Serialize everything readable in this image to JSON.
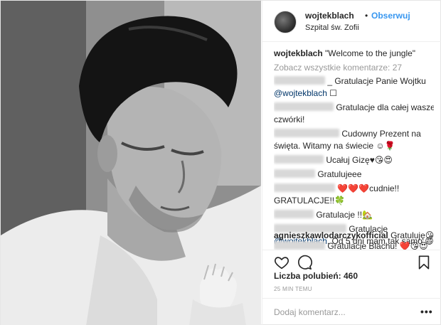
{
  "header": {
    "username": "wojtekblach",
    "dot": "•",
    "follow_label": "Obserwuj",
    "location": "Szpital św. Zofii"
  },
  "caption": {
    "username": "wojtekblach",
    "text": "\"Welcome to the jungle\""
  },
  "view_all_comments": "Zobacz wszystkie komentarze: 27",
  "comments": [
    {
      "text": "_ Gratulacje Panie Wojtku"
    },
    {
      "mention": "@wojtekblach",
      "text": " ☐"
    },
    {
      "text": "Gratulacje dla całej waszej"
    },
    {
      "text": "czwórki!"
    },
    {
      "text": "Cudowny Prezent na"
    },
    {
      "text": "święta. Witamy na świecie ☺🌹"
    },
    {
      "text": "Ucałuj Gizę♥😘😍"
    },
    {
      "text": "Gratulujeee"
    },
    {
      "text": "❤️❤️❤️cudnie!!"
    },
    {
      "text": "GRATULACJE!!🍀"
    },
    {
      "text": "Gratulacje !!🏡"
    },
    {
      "text": "Gratulacje"
    },
    {
      "mention": "@wojtekblach",
      "text": ". Od 5 dni mam tak samo 😄"
    },
    {
      "username": "agnieszkawlodarczykofficial",
      "text": " Gratuluję😘"
    },
    {
      "text": "Gratulacje Blachu! ❤️😘😍"
    }
  ],
  "actions": {
    "like_icon": "heart-icon",
    "comment_icon": "speech-bubble-icon",
    "save_icon": "bookmark-icon"
  },
  "likes": "Liczba polubień: 460",
  "timestamp": "25 MIN TEMU",
  "composer": {
    "placeholder": "Dodaj komentarz...",
    "more_label": "•••"
  },
  "colors": {
    "accent": "#3897f0",
    "mention": "#003569",
    "muted": "#999999",
    "border": "#efefef"
  }
}
